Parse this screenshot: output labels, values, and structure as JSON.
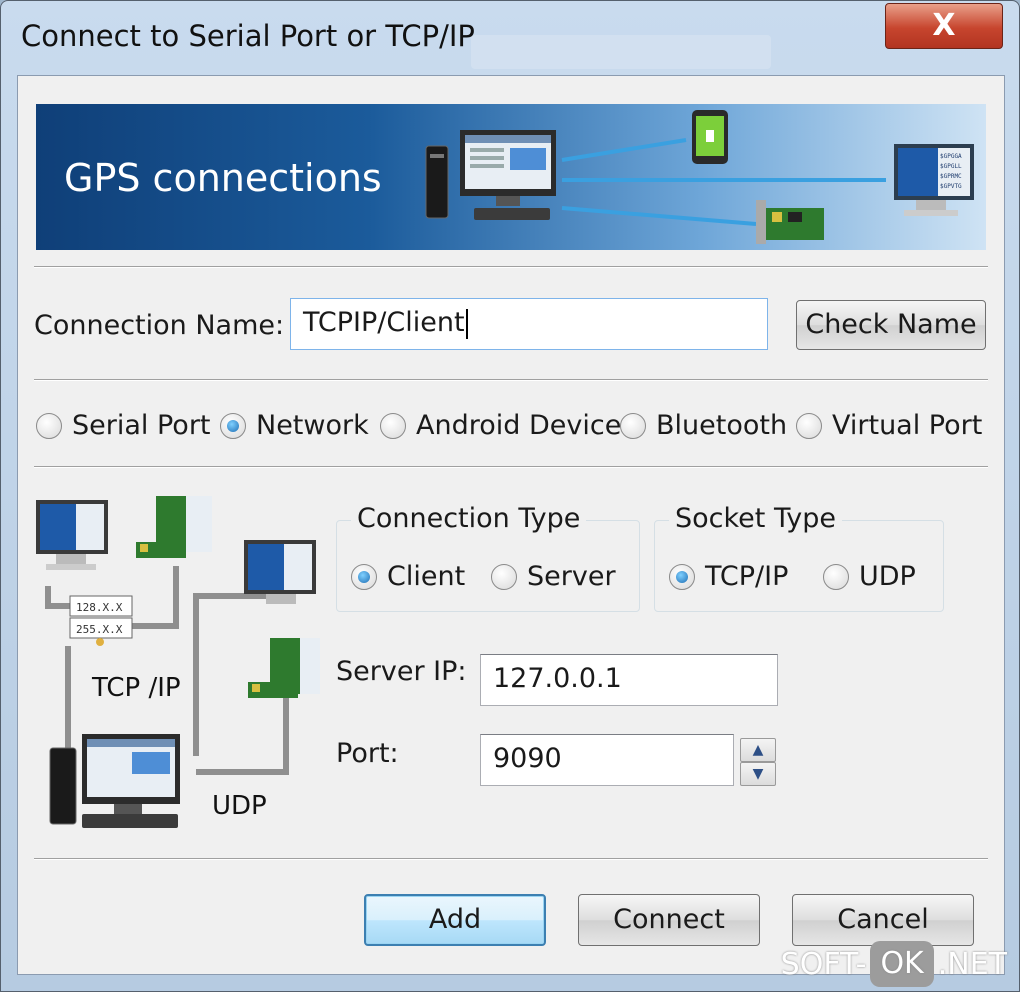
{
  "window": {
    "title": "Connect to Serial Port or TCP/IP",
    "close_label": "X"
  },
  "banner": {
    "title": "GPS connections",
    "monitor_lines": [
      "$GPGGA",
      "$GPGLL",
      "$GPRMC",
      "$GPVTG"
    ]
  },
  "connection_name": {
    "label": "Connection Name:",
    "value": "TCPIP/Client",
    "check_button": "Check Name"
  },
  "connection_modes": {
    "options": [
      "Serial Port",
      "Network",
      "Android Device",
      "Bluetooth",
      "Virtual Port"
    ],
    "selected": "Network"
  },
  "diagram": {
    "tcp_label": "TCP /IP",
    "udp_label": "UDP",
    "ip_box_1": "128.X.X",
    "ip_box_2": "255.X.X"
  },
  "connection_type": {
    "title": "Connection Type",
    "options": [
      "Client",
      "Server"
    ],
    "selected": "Client"
  },
  "socket_type": {
    "title": "Socket Type",
    "options": [
      "TCP/IP",
      "UDP"
    ],
    "selected": "TCP/IP"
  },
  "server_ip": {
    "label": "Server IP:",
    "value": "127.0.0.1"
  },
  "port": {
    "label": "Port:",
    "value": "9090",
    "up_icon": "spin-up-icon",
    "down_icon": "spin-down-icon"
  },
  "footer": {
    "add_label": "Add",
    "connect_label": "Connect",
    "cancel_label": "Cancel"
  },
  "watermark": {
    "left": "SOFT-",
    "mid": "OK",
    "right": ".NET"
  },
  "colors": {
    "banner_dark": "#0f3f78",
    "banner_light": "#cfe3f4",
    "accent": "#3c7fb1",
    "close": "#c7452e"
  }
}
